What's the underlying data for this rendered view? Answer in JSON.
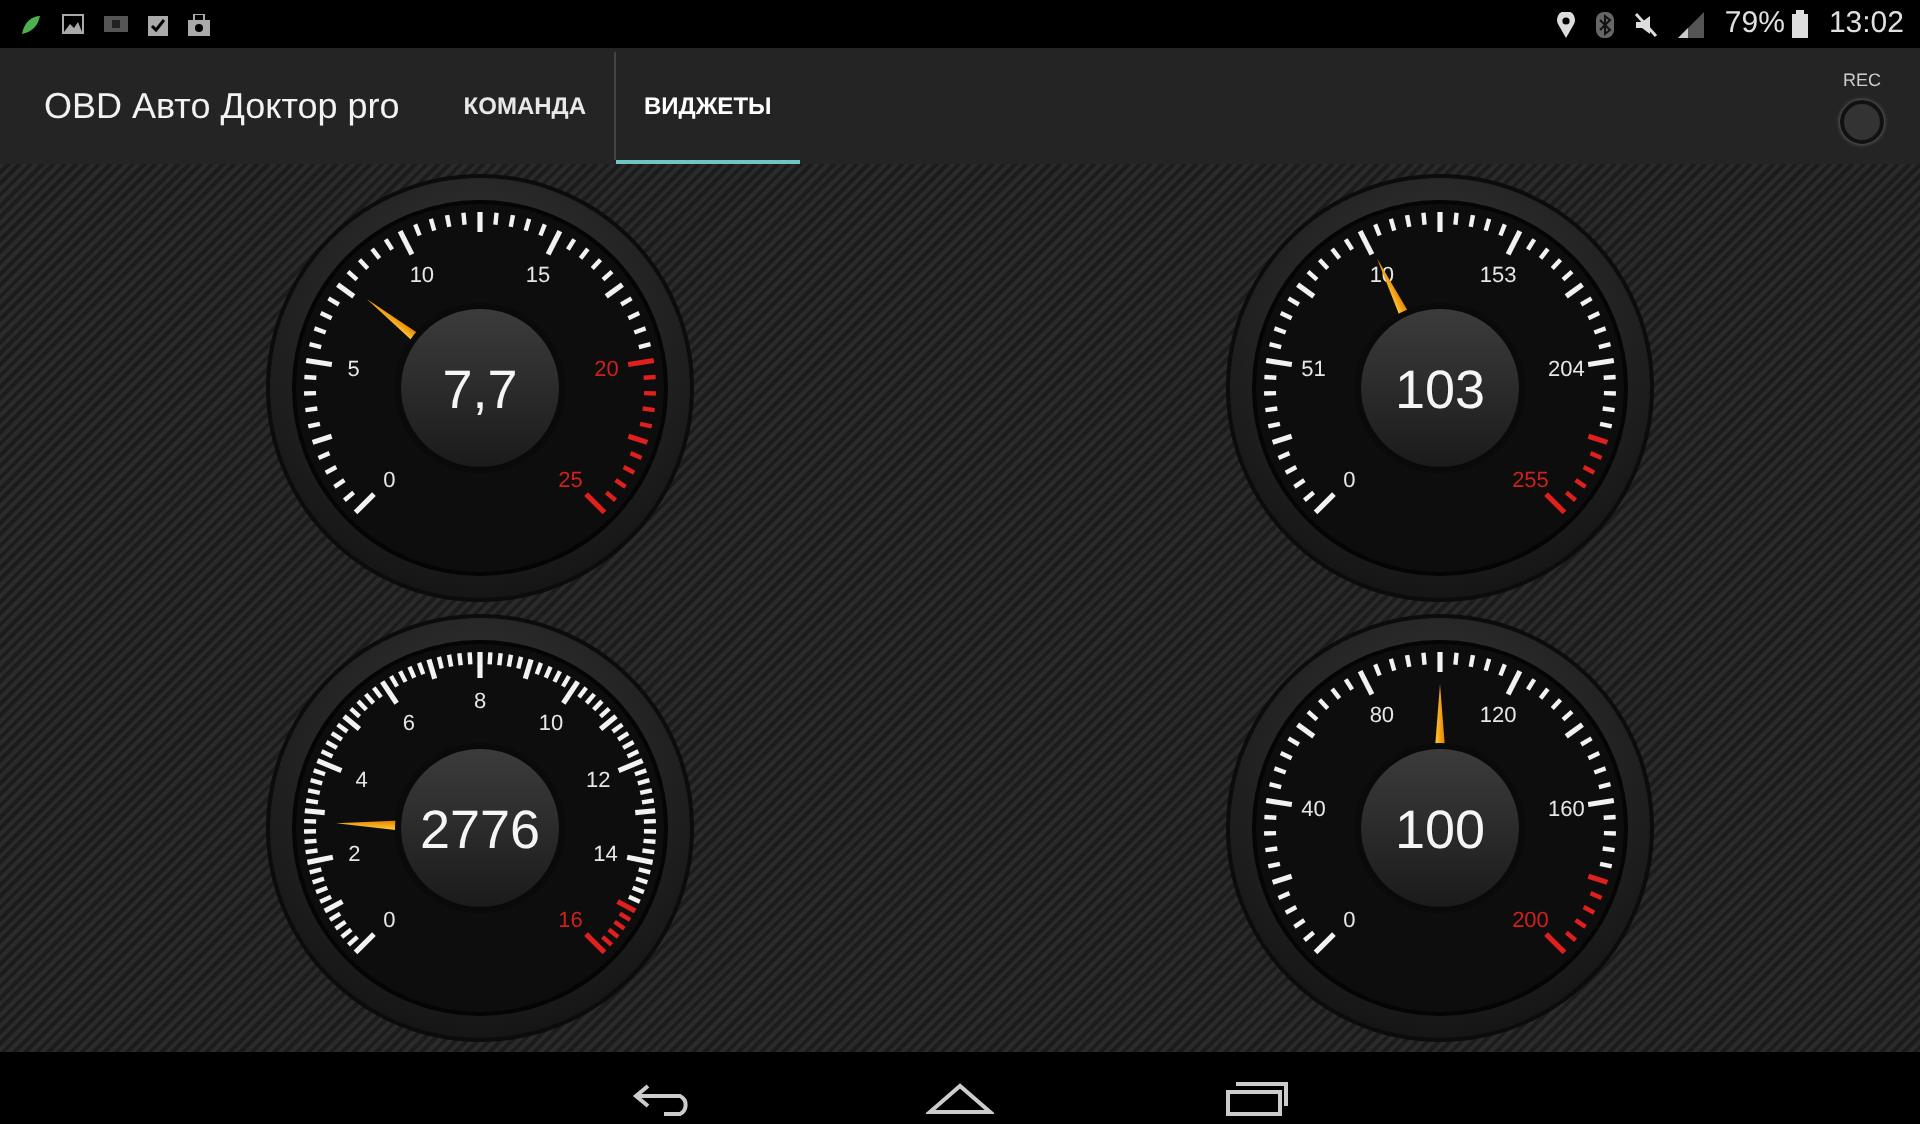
{
  "status_bar": {
    "battery": "79%",
    "time": "13:02"
  },
  "app_bar": {
    "title": "OBD Авто Доктор pro",
    "rec_label": "REC",
    "tabs": [
      {
        "label": "КОМАНДА",
        "selected": false
      },
      {
        "label": "ВИДЖЕТЫ",
        "selected": true
      }
    ]
  },
  "gauges": [
    {
      "reading": "7,7",
      "level": 0.308,
      "scale": [
        {
          "label": "0",
          "warning": false
        },
        {
          "label": "5",
          "warning": false
        },
        {
          "label": "10",
          "warning": false
        },
        {
          "label": "15",
          "warning": false
        },
        {
          "label": "20",
          "warning": true
        },
        {
          "label": "25",
          "warning": true
        }
      ]
    },
    {
      "reading": "103",
      "level": 0.404,
      "scale": [
        {
          "label": "0",
          "warning": false
        },
        {
          "label": "51",
          "warning": false
        },
        {
          "label": "10",
          "warning": false
        },
        {
          "label": "153",
          "warning": false
        },
        {
          "label": "204",
          "warning": false
        },
        {
          "label": "255",
          "warning": true
        }
      ]
    },
    {
      "reading": "2776",
      "level": 0.1735,
      "scale": [
        {
          "label": "0",
          "warning": false
        },
        {
          "label": "2",
          "warning": false
        },
        {
          "label": "4",
          "warning": false
        },
        {
          "label": "6",
          "warning": false
        },
        {
          "label": "8",
          "warning": false
        },
        {
          "label": "10",
          "warning": false
        },
        {
          "label": "12",
          "warning": false
        },
        {
          "label": "14",
          "warning": false
        },
        {
          "label": "16",
          "warning": true
        }
      ]
    },
    {
      "reading": "100",
      "level": 0.5,
      "scale": [
        {
          "label": "0",
          "warning": false
        },
        {
          "label": "40",
          "warning": false
        },
        {
          "label": "80",
          "warning": false
        },
        {
          "label": "120",
          "warning": false
        },
        {
          "label": "160",
          "warning": false
        },
        {
          "label": "200",
          "warning": true
        }
      ]
    }
  ]
}
